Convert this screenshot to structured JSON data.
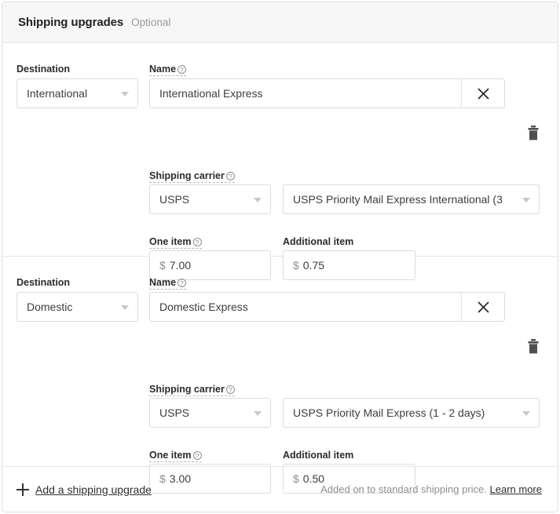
{
  "header": {
    "title": "Shipping upgrades",
    "optional_label": "Optional"
  },
  "labels": {
    "destination": "Destination",
    "name": "Name",
    "shipping_carrier": "Shipping carrier",
    "one_item": "One item",
    "additional_item": "Additional item",
    "help_icon_glyph": "?",
    "currency_symbol": "$"
  },
  "rows": [
    {
      "destination": "International",
      "name": "International Express",
      "carrier": "USPS",
      "service": "USPS Priority Mail Express International (3",
      "one_item_price": "7.00",
      "additional_item_price": "0.75",
      "clear_icon": "close-icon",
      "delete_icon": "trash-icon"
    },
    {
      "destination": "Domestic",
      "name": "Domestic Express",
      "carrier": "USPS",
      "service": "USPS Priority Mail Express (1 - 2 days)",
      "one_item_price": "3.00",
      "additional_item_price": "0.50",
      "clear_icon": "close-icon",
      "delete_icon": "trash-icon"
    }
  ],
  "footer": {
    "add_label": "Add a shipping upgrade",
    "note": "Added on to standard shipping price.",
    "learn_more": "Learn more"
  },
  "colors": {
    "header_bg": "#f7f7f7",
    "border": "#e1e3df",
    "text": "#2b2b2b",
    "muted": "#8e8e8e"
  }
}
